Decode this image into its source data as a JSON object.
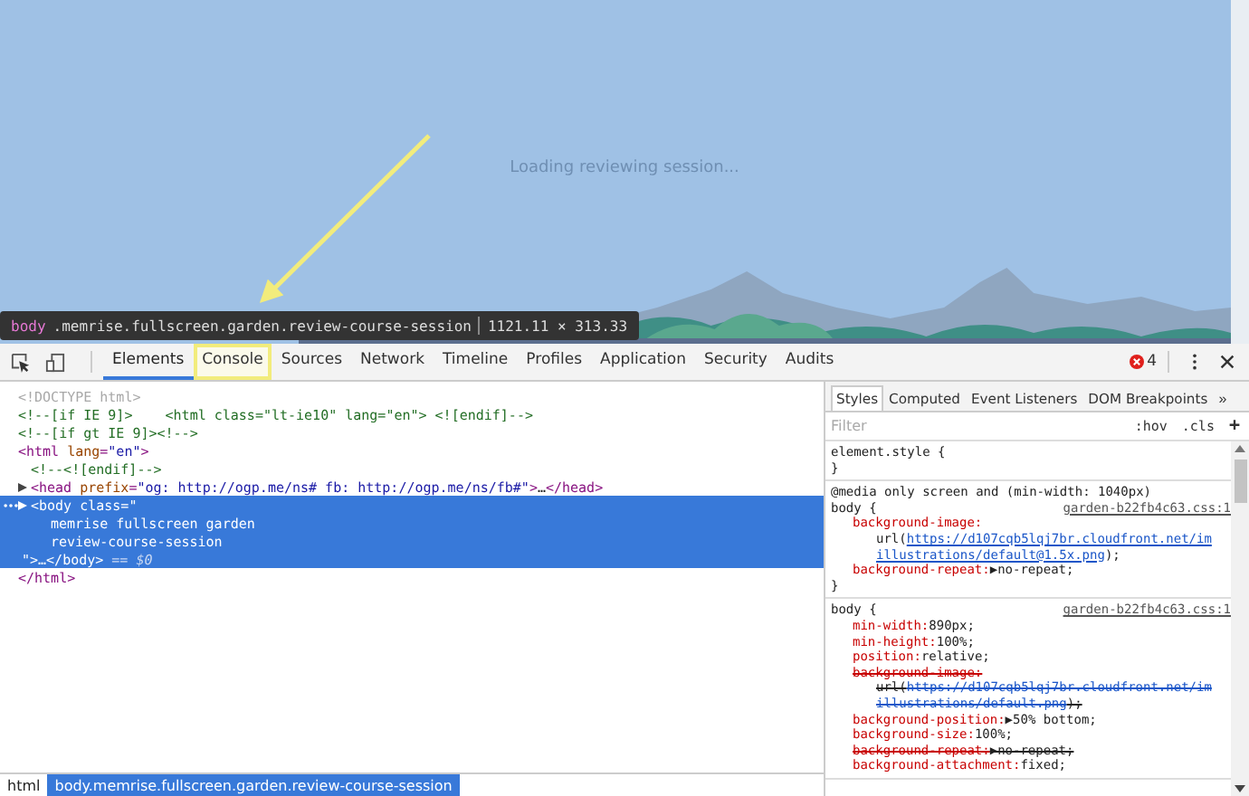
{
  "page": {
    "loading_text": "Loading reviewing session..."
  },
  "inspect_tooltip": {
    "tag": "body",
    "classes": ".memrise.fullscreen.garden.review-course-session",
    "size": "1121.11 × 313.33"
  },
  "devtools": {
    "tabs": [
      {
        "label": "Elements",
        "selected": true,
        "annotated": false
      },
      {
        "label": "Console",
        "selected": false,
        "annotated": true
      },
      {
        "label": "Sources",
        "selected": false,
        "annotated": false
      },
      {
        "label": "Network",
        "selected": false,
        "annotated": false
      },
      {
        "label": "Timeline",
        "selected": false,
        "annotated": false
      },
      {
        "label": "Profiles",
        "selected": false,
        "annotated": false
      },
      {
        "label": "Application",
        "selected": false,
        "annotated": false
      },
      {
        "label": "Security",
        "selected": false,
        "annotated": false
      },
      {
        "label": "Audits",
        "selected": false,
        "annotated": false
      }
    ],
    "error_count": "4"
  },
  "elements": [
    {
      "collapsed": false,
      "selected": false,
      "lines": [
        {
          "kind": "open",
          "tokens": [
            {
              "kind": "doctype",
              "text": "<!DOCTYPE html>"
            }
          ]
        }
      ]
    },
    {
      "collapsed": false,
      "selected": false,
      "lines": [
        {
          "kind": "open",
          "tokens": [
            {
              "kind": "comment",
              "text": "<!--[if IE 9]>    <html class=\"lt-ie10\" lang=\"en\"> <![endif]-->"
            }
          ]
        }
      ]
    },
    {
      "collapsed": false,
      "selected": false,
      "lines": [
        {
          "kind": "open",
          "tokens": [
            {
              "kind": "comment",
              "text": "<!--[if gt IE 9]><!-->"
            }
          ]
        }
      ]
    },
    {
      "collapsed": false,
      "selected": false,
      "lines": [
        {
          "kind": "open",
          "tokens": [
            {
              "kind": "tag",
              "text": "<html"
            },
            {
              "kind": "attr",
              "text": " lang"
            },
            {
              "kind": "tag",
              "text": "="
            },
            {
              "kind": "value",
              "text": "\"en\""
            },
            {
              "kind": "tag",
              "text": ">"
            }
          ]
        }
      ],
      "closing": [
        {
          "kind": "tag",
          "text": "</html>"
        }
      ],
      "children": [
        {
          "collapsed": false,
          "selected": false,
          "lines": [
            {
              "kind": "open",
              "tokens": [
                {
                  "kind": "comment",
                  "text": "<!--<![endif]-->"
                }
              ]
            }
          ]
        },
        {
          "collapsed": true,
          "selected": false,
          "lines": [
            {
              "kind": "open",
              "tokens": [
                {
                  "kind": "tag",
                  "text": "<head"
                },
                {
                  "kind": "attr",
                  "text": " prefix"
                },
                {
                  "kind": "tag",
                  "text": "="
                },
                {
                  "kind": "value",
                  "text": "\"og: http://ogp.me/ns# fb: http://ogp.me/ns/fb#\""
                },
                {
                  "kind": "tag",
                  "text": ">"
                },
                {
                  "kind": "text",
                  "text": "…"
                },
                {
                  "kind": "tag",
                  "text": "</head>"
                }
              ]
            }
          ]
        },
        {
          "collapsed": true,
          "selected": true,
          "lines": [
            {
              "kind": "open",
              "tokens": [
                {
                  "kind": "tag",
                  "text": "<body"
                },
                {
                  "kind": "attr",
                  "text": " class"
                },
                {
                  "kind": "tag",
                  "text": "="
                },
                {
                  "kind": "value",
                  "text": "\""
                }
              ]
            },
            {
              "kind": "value",
              "tokens": [
                {
                  "kind": "value",
                  "text": "memrise fullscreen garden"
                }
              ]
            },
            {
              "kind": "value",
              "tokens": [
                {
                  "kind": "value",
                  "text": "review-course-session"
                }
              ]
            },
            {
              "kind": "close",
              "tokens": [
                {
                  "kind": "value",
                  "text": "\""
                },
                {
                  "kind": "tag",
                  "text": ">"
                },
                {
                  "kind": "text",
                  "text": "…"
                },
                {
                  "kind": "tag",
                  "text": "</body>"
                },
                {
                  "kind": "dim",
                  "text": " == $0"
                }
              ]
            }
          ]
        }
      ]
    }
  ],
  "styles_pane": {
    "tabs": [
      {
        "label": "Styles",
        "selected": true
      },
      {
        "label": "Computed",
        "selected": false
      },
      {
        "label": "Event Listeners",
        "selected": false
      },
      {
        "label": "DOM Breakpoints",
        "selected": false
      }
    ],
    "more": "»",
    "filter": {
      "placeholder": "Filter"
    },
    "hov": ":hov",
    "cls": ".cls",
    "add": "+",
    "rules": [
      {
        "selector": "element.style {",
        "close": "}"
      },
      {
        "media": "@media only screen and (min-width: 1040px)",
        "selector": "body {",
        "source": "garden-b22fb4c63.css:1",
        "close": "}",
        "declarations": [
          {
            "name": "background-image:",
            "overridden": false,
            "wrapped": true,
            "value_lines": [
              [
                {
                  "kind": "text",
                  "text": "url("
                },
                {
                  "kind": "link",
                  "text": "https://d107cqb5lqj7br.cloudfront.net/im"
                }
              ],
              [
                {
                  "kind": "link",
                  "text": "illustrations/default@1.5x.png"
                },
                {
                  "kind": "text",
                  "text": ");"
                }
              ]
            ]
          },
          {
            "name": "background-repeat:",
            "overridden": false,
            "wrapped": false,
            "value_lines": [
              [
                {
                  "kind": "text",
                  "text": "▶no-repeat;"
                }
              ]
            ]
          }
        ]
      },
      {
        "selector": "body {",
        "source": "garden-b22fb4c63.css:1",
        "declarations": [
          {
            "name": "min-width:",
            "overridden": false,
            "wrapped": false,
            "value_lines": [
              [
                {
                  "kind": "text",
                  "text": "890px;"
                }
              ]
            ]
          },
          {
            "name": "min-height:",
            "overridden": false,
            "wrapped": false,
            "value_lines": [
              [
                {
                  "kind": "text",
                  "text": "100%;"
                }
              ]
            ]
          },
          {
            "name": "position:",
            "overridden": false,
            "wrapped": false,
            "value_lines": [
              [
                {
                  "kind": "text",
                  "text": "relative;"
                }
              ]
            ]
          },
          {
            "name": "background-image:",
            "overridden": true,
            "wrapped": true,
            "value_lines": [
              [
                {
                  "kind": "text",
                  "text": "url("
                },
                {
                  "kind": "link",
                  "text": "https://d107cqb5lqj7br.cloudfront.net/im"
                }
              ],
              [
                {
                  "kind": "link",
                  "text": "illustrations/default.png"
                },
                {
                  "kind": "text",
                  "text": ");"
                }
              ]
            ]
          },
          {
            "name": "background-position:",
            "overridden": false,
            "wrapped": false,
            "value_lines": [
              [
                {
                  "kind": "text",
                  "text": "▶50% bottom;"
                }
              ]
            ]
          },
          {
            "name": "background-size:",
            "overridden": false,
            "wrapped": false,
            "value_lines": [
              [
                {
                  "kind": "text",
                  "text": "100%;"
                }
              ]
            ]
          },
          {
            "name": "background-repeat:",
            "overridden": true,
            "wrapped": false,
            "value_lines": [
              [
                {
                  "kind": "text",
                  "text": "▶no-repeat;"
                }
              ]
            ]
          },
          {
            "name": "background-attachment:",
            "overridden": false,
            "wrapped": false,
            "value_lines": [
              [
                {
                  "kind": "text",
                  "text": "fixed;"
                }
              ]
            ]
          }
        ]
      }
    ]
  },
  "breadcrumb": [
    {
      "label": "html",
      "selected": false
    },
    {
      "label": "body.memrise.fullscreen.garden.review-course-session",
      "selected": true
    }
  ]
}
